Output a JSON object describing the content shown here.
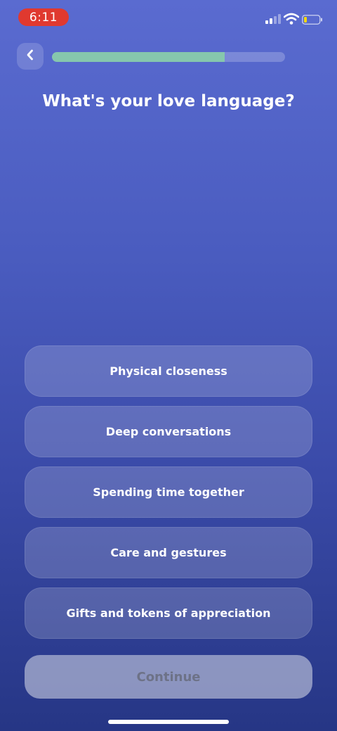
{
  "status_bar": {
    "time": "6:11",
    "time_pill_color": "#e0392f",
    "icons": [
      "cellular-signal-icon",
      "wifi-icon",
      "battery-low-icon"
    ]
  },
  "header": {
    "back_icon": "chevron-left-icon",
    "progress": 0.74,
    "progress_color": "#86c7ad"
  },
  "question": {
    "title": "What's your love language?"
  },
  "options": [
    {
      "label": "Physical closeness"
    },
    {
      "label": "Deep conversations"
    },
    {
      "label": "Spending time together"
    },
    {
      "label": "Care and gestures"
    },
    {
      "label": "Gifts and tokens of appreciation"
    }
  ],
  "footer": {
    "continue_label": "Continue"
  }
}
